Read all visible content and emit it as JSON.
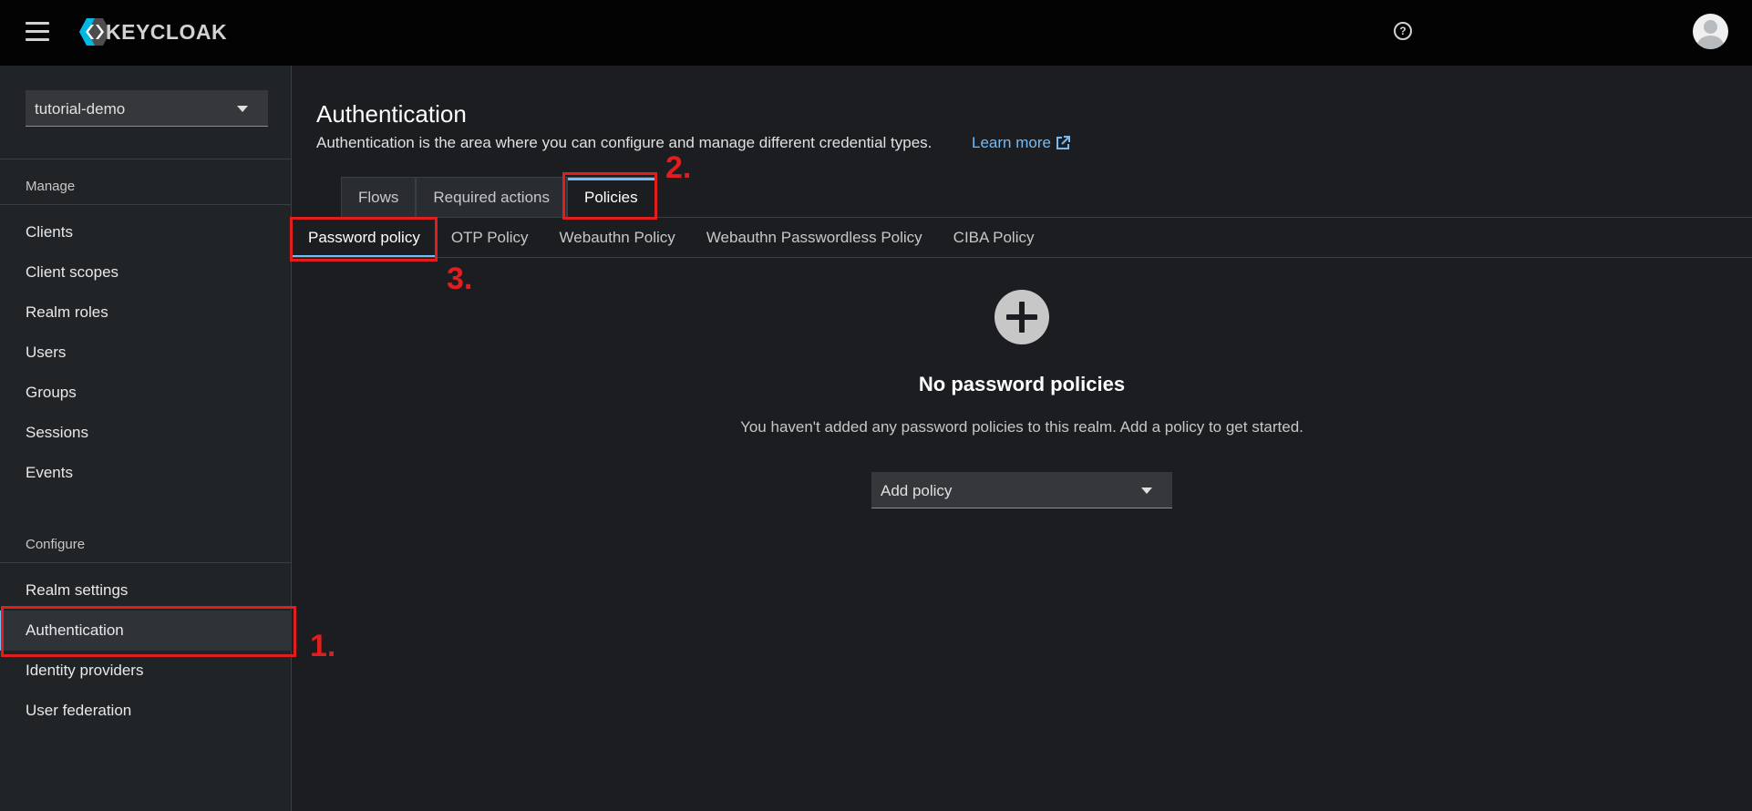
{
  "masthead": {
    "logo_text": "KEYCLOAK",
    "help_icon_glyph": "?"
  },
  "sidebar": {
    "realm": "tutorial-demo",
    "manage_title": "Manage",
    "manage_items": [
      "Clients",
      "Client scopes",
      "Realm roles",
      "Users",
      "Groups",
      "Sessions",
      "Events"
    ],
    "configure_title": "Configure",
    "configure_items": [
      "Realm settings",
      "Authentication",
      "Identity providers",
      "User federation"
    ],
    "active_item": "Authentication"
  },
  "main": {
    "title": "Authentication",
    "description": "Authentication is the area where you can configure and manage different credential types.",
    "learn_more": "Learn more",
    "tabs": [
      "Flows",
      "Required actions",
      "Policies"
    ],
    "active_tab": "Policies",
    "subtabs": [
      "Password policy",
      "OTP Policy",
      "Webauthn Policy",
      "Webauthn Passwordless Policy",
      "CIBA Policy"
    ],
    "active_subtab": "Password policy",
    "empty_state": {
      "title": "No password policies",
      "body": "You haven't added any password policies to this realm. Add a policy to get started.",
      "select_label": "Add policy"
    }
  },
  "annotations": [
    "1.",
    "2.",
    "3."
  ],
  "colors": {
    "accent": "#73bcf7",
    "annotation": "#e01e1e",
    "masthead_bg": "#030303",
    "sidebar_bg": "#212427",
    "page_bg": "#1b1d21"
  }
}
